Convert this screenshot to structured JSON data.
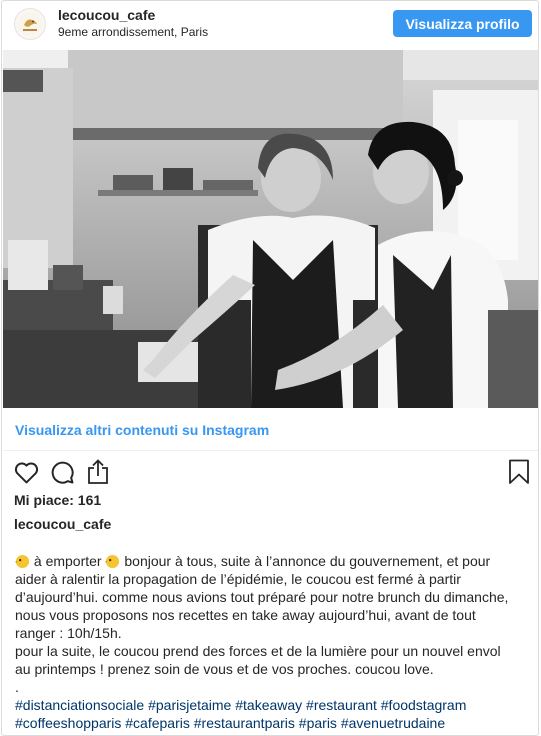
{
  "header": {
    "username": "lecoucou_cafe",
    "location": "9eme arrondissement, Paris",
    "profile_button": "Visualizza profilo",
    "avatar_icon": "lecoucou-logo-icon"
  },
  "media": {
    "more_link": "Visualizza altri contenuti su Instagram"
  },
  "actions": {
    "icons": [
      "heart-icon",
      "comment-icon",
      "share-icon",
      "bookmark-icon"
    ]
  },
  "stats": {
    "likes": "Mi piace: 161"
  },
  "caption": {
    "username": "lecoucou_cafe",
    "line1_a": "à emporter",
    "line1_b": "bonjour à tous, suite à l’annonce du gouvernement, et pour",
    "line2": "aider à ralentir la propagation de l’épidémie, le coucou est fermé à partir",
    "line3": "d’aujourd’hui. comme nous avions tout préparé pour notre brunch du dimanche,",
    "line4": "nous vous proposons nos recettes en take away aujourd’hui, avant de tout",
    "line5": "ranger : 10h/15h.",
    "line6": "pour la suite, le coucou prend des forces et de la lumière pour un nouvel envol",
    "line7": "au printemps ! prenez soin de vous et de vos proches. coucou love.",
    "line8": ".",
    "hashtags1": "#distanciationsociale #parisjetaime #takeaway #restaurant #foodstagram",
    "hashtags2": "#coffeeshopparis #cafeparis #restaurantparis #paris #avenuetrudaine",
    "emoji_icon": "bird-emoji-icon"
  },
  "colors": {
    "accent": "#3897f0",
    "hashtag": "#003569",
    "text": "#262626"
  }
}
